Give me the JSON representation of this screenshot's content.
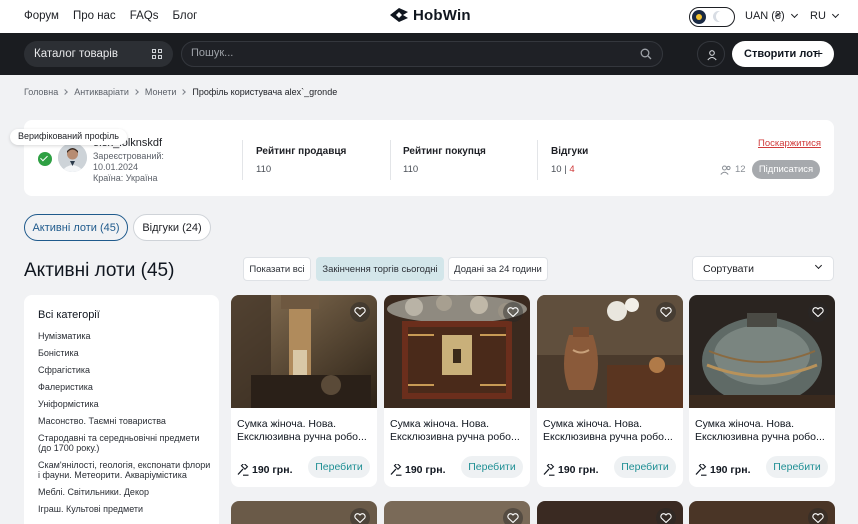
{
  "topnav": {
    "links": [
      "Форум",
      "Про нас",
      "FAQs",
      "Блог"
    ],
    "logo": "HobWin",
    "currency": "UAN (₴)",
    "language": "RU"
  },
  "toolbar": {
    "catalog_label": "Каталог товарів",
    "search_placeholder": "Пошук...",
    "create_label": "Створити лот",
    "create_plus": "+"
  },
  "breadcrumb": [
    "Головна",
    "Антикваріати",
    "Монети",
    "Профіль користувача alex`_gronde"
  ],
  "profile": {
    "verified_label": "Верифікований профіль",
    "username": "olex_lolknskdf",
    "registered_label": "Зареєстрований: 10.01.2024",
    "country_label": "Країна: Україна",
    "seller_rating_label": "Рейтинг продавця",
    "seller_rating_value": "110",
    "buyer_rating_label": "Рейтинг покупця",
    "buyer_rating_value": "110",
    "reviews_label": "Відгуки",
    "reviews_positive": "10",
    "reviews_negative": "4",
    "complain_label": "Поскаржитися",
    "followers_count": "12",
    "subscribe_label": "Підписатися"
  },
  "tabs": {
    "active": "Активні лоти (45)",
    "reviews": "Відгуки (24)"
  },
  "lots": {
    "title": "Активні лоти (45)",
    "filters": [
      "Показати всі",
      "Закінчення торгів сьогодні",
      "Додані за 24 години"
    ],
    "sort_label": "Сортувати"
  },
  "categories": {
    "head": "Всі категорії",
    "items": [
      "Нумізматика",
      "Боністика",
      "Сфрагістика",
      "Фалеристика",
      "Уніформістика",
      "Масонство. Таємні товариства",
      "Стародавні та середньовічні предмети (до 1700 року.)",
      "Скам'янілості, геологія, експонати флори і фауни. Метеорити. Акваріумістика",
      "Меблі. Світильники. Декор",
      "Іграш. Культові предмети"
    ]
  },
  "products": [
    {
      "title_line1": "Сумка жіноча. Нова.",
      "title_line2": "Ексклюзивна ручна робо...",
      "price": "190 грн.",
      "bid_label": "Перебити"
    },
    {
      "title_line1": "Сумка жіноча. Нова.",
      "title_line2": "Ексклюзивна ручна робо...",
      "price": "190 грн.",
      "bid_label": "Перебити"
    },
    {
      "title_line1": "Сумка жіноча. Нова.",
      "title_line2": "Ексклюзивна ручна робо...",
      "price": "190 грн.",
      "bid_label": "Перебити"
    },
    {
      "title_line1": "Сумка жіноча. Нова.",
      "title_line2": "Ексклюзивна ручна робо...",
      "price": "190 грн.",
      "bid_label": "Перебити"
    }
  ],
  "icons": {
    "theme": "sun-moon-toggle-icon",
    "grid": "grid-icon",
    "search": "search-icon",
    "user": "user-icon",
    "favorite": "heart-icon",
    "auction": "gavel-icon",
    "followers": "users-icon"
  },
  "colors": {
    "accent": "#1f5a8c",
    "bid_text": "#1e8f94",
    "negative": "#d03a3a",
    "verified": "#2ea043",
    "dark_bar": "#1a1c20"
  }
}
